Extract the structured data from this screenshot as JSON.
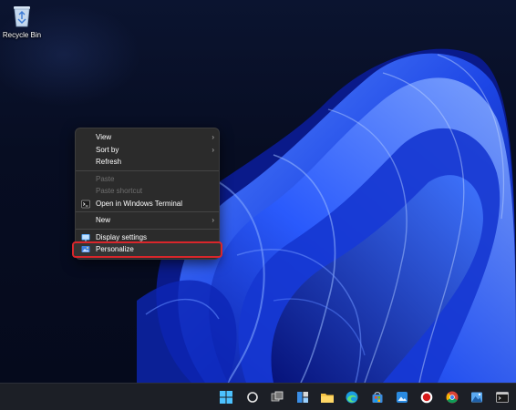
{
  "desktop": {
    "icons": [
      {
        "label": "Recycle Bin"
      }
    ]
  },
  "context_menu": {
    "items": [
      {
        "label": "View",
        "submenu": true
      },
      {
        "label": "Sort by",
        "submenu": true
      },
      {
        "label": "Refresh"
      },
      {
        "label": "Paste",
        "disabled": true
      },
      {
        "label": "Paste shortcut",
        "disabled": true
      },
      {
        "label": "Open in Windows Terminal",
        "icon": "terminal-icon"
      },
      {
        "label": "New",
        "submenu": true
      },
      {
        "label": "Display settings",
        "icon": "display-icon"
      },
      {
        "label": "Personalize",
        "icon": "personalize-icon",
        "highlighted": true
      }
    ]
  },
  "taskbar": {
    "items": [
      "windows-start-icon",
      "search-icon",
      "task-view-icon",
      "widgets-icon",
      "file-explorer-icon",
      "edge-icon",
      "microsoft-store-icon",
      "photos-icon",
      "record-icon",
      "chrome-icon",
      "image-viewer-icon",
      "terminal-icon"
    ]
  },
  "colors": {
    "menu_bg": "#2b2b2b",
    "highlight_outline": "#d9262b",
    "taskbar_bg": "#1c1f26",
    "wallpaper_bloom": "#1f4df0"
  }
}
